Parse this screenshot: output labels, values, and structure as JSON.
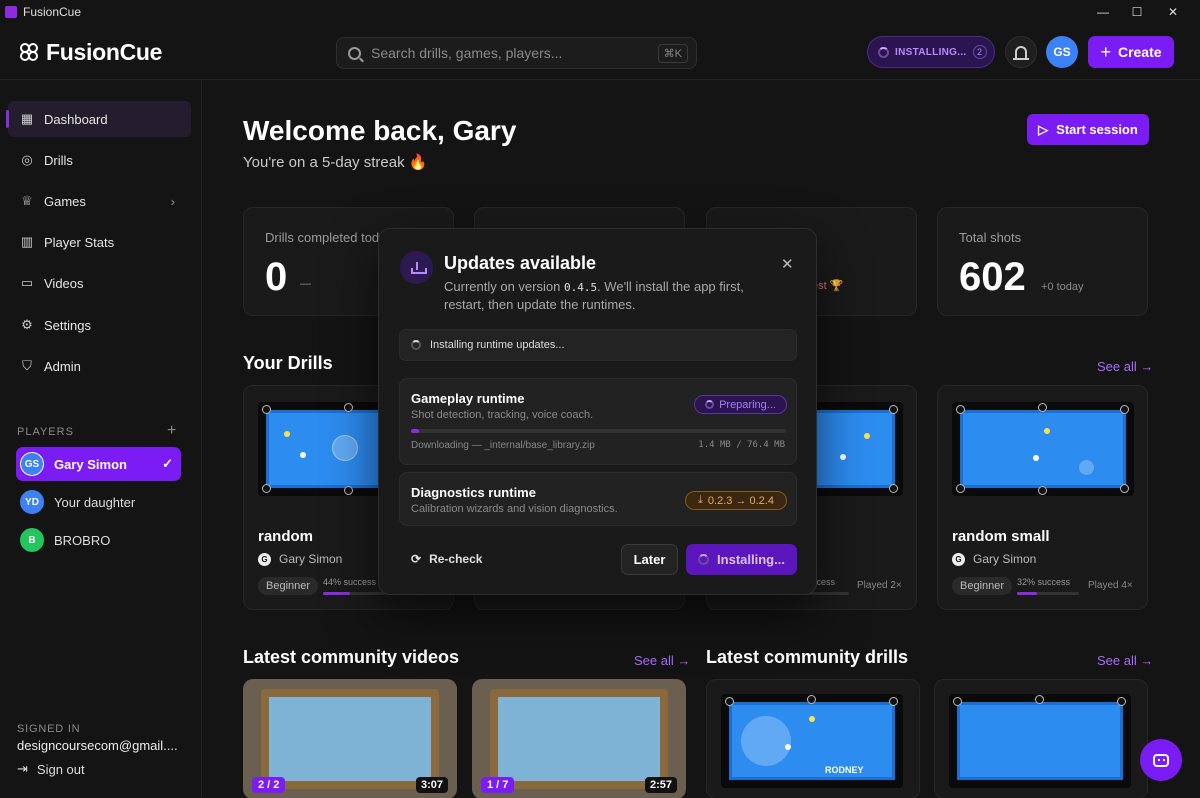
{
  "window": {
    "title": "FusionCue",
    "minimize": "—",
    "maximize": "☐",
    "close": "✕"
  },
  "header": {
    "logo_text": "FusionCue",
    "search_placeholder": "Search drills, games, players...",
    "search_shortcut": "⌘K",
    "installing_label": "INSTALLING...",
    "installing_count": "2",
    "avatar_initials": "GS",
    "create_label": "Create"
  },
  "sidebar": {
    "items": [
      {
        "label": "Dashboard",
        "icon": "grid-icon"
      },
      {
        "label": "Drills",
        "icon": "target-icon"
      },
      {
        "label": "Games",
        "icon": "trophy-icon"
      },
      {
        "label": "Player Stats",
        "icon": "bar-chart-icon"
      },
      {
        "label": "Videos",
        "icon": "video-icon"
      },
      {
        "label": "Settings",
        "icon": "gear-icon"
      },
      {
        "label": "Admin",
        "icon": "shield-icon"
      }
    ],
    "players_label": "PLAYERS",
    "players": [
      {
        "initials": "GS",
        "name": "Gary Simon",
        "color": "#3b82f6"
      },
      {
        "initials": "YD",
        "name": "Your daughter",
        "color": "#3b82f6"
      },
      {
        "initials": "B",
        "name": "BROBRO",
        "color": "#22c55e"
      }
    ],
    "signed_in_label": "SIGNED IN",
    "signed_in_email": "designcoursecom@gmail....",
    "sign_out_label": "Sign out"
  },
  "main": {
    "welcome": "Welcome back, Gary",
    "streak": "You're on a 5-day streak 🔥",
    "start_session": "Start session",
    "stats": [
      {
        "label": "Drills completed tod",
        "value": "0",
        "sub": "—"
      },
      {
        "label": "",
        "value": "",
        "sub": ""
      },
      {
        "label": "",
        "value": "",
        "sub": "est 🏆"
      },
      {
        "label": "Total shots",
        "value": "602",
        "sub": "+0 today"
      }
    ],
    "your_drills_title": "Your Drills",
    "see_all": "See all →",
    "drills": [
      {
        "name": "random",
        "author": "Gary Simon",
        "level": "Beginner",
        "success": "44% success",
        "success_pct": 0.44,
        "played": ""
      },
      {
        "name": "",
        "author": "",
        "level": "",
        "success": "",
        "success_pct": 0.3,
        "played": ""
      },
      {
        "name": "",
        "author": "",
        "level": "",
        "success": "ccess",
        "success_pct": 0.3,
        "played": "Played 2×"
      },
      {
        "name": "random small",
        "author": "Gary Simon",
        "level": "Beginner",
        "success": "32% success",
        "success_pct": 0.32,
        "played": "Played 4×"
      }
    ],
    "videos_title": "Latest community videos",
    "videos": [
      {
        "badge": "2 / 2",
        "duration": "3:07"
      },
      {
        "badge": "1 / 7",
        "duration": "2:57"
      }
    ],
    "community_drills_title": "Latest community drills",
    "community_drill_label": "RODNEY"
  },
  "modal": {
    "title": "Updates available",
    "desc_prefix": "Currently on version",
    "version": "0.4.5",
    "desc_suffix": ". We'll install the app first, restart, then update the runtimes.",
    "status": "Installing runtime updates...",
    "runtimes": [
      {
        "name": "Gameplay runtime",
        "desc": "Shot detection, tracking, voice coach.",
        "state": "Preparing...",
        "progress": 0.02,
        "download_line": "Downloading — _internal/base_library.zip",
        "download_size": "1.4 MB / 76.4 MB"
      },
      {
        "name": "Diagnostics runtime",
        "desc": "Calibration wizards and vision diagnostics.",
        "version_change": "0.2.3 → 0.2.4"
      }
    ],
    "recheck": "Re-check",
    "later": "Later",
    "install": "Installing..."
  },
  "colors": {
    "accent": "#7c1cf5",
    "felt": "#2d8cf0",
    "warning": "#f0a84a"
  }
}
